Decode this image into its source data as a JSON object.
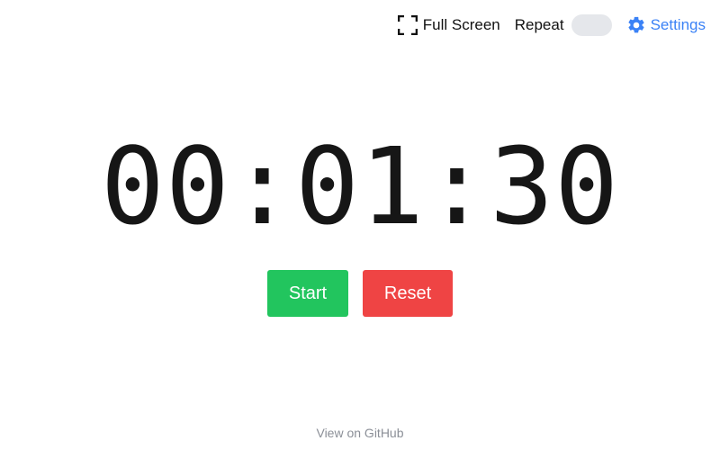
{
  "toolbar": {
    "fullscreen_label": "Full Screen",
    "repeat_label": "Repeat",
    "repeat_enabled": false,
    "settings_label": "Settings"
  },
  "timer": {
    "display": "00:01:30"
  },
  "controls": {
    "start_label": "Start",
    "reset_label": "Reset"
  },
  "footer": {
    "link_label": "View on GitHub"
  },
  "colors": {
    "start": "#22c55e",
    "reset": "#ef4444",
    "settings": "#3b82f6",
    "toggle_off": "#e5e7eb"
  },
  "icons": {
    "fullscreen": "fullscreen-icon",
    "settings": "gear-icon"
  }
}
